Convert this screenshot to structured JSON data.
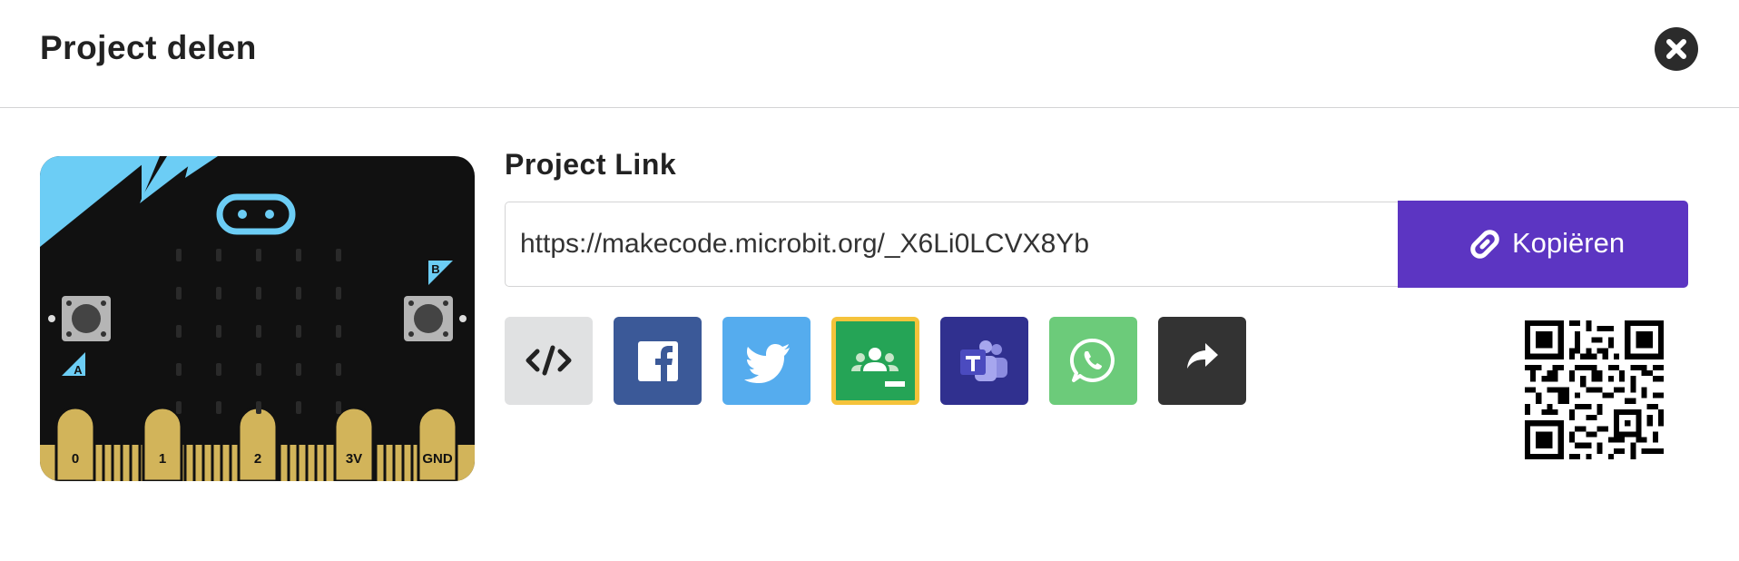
{
  "dialog": {
    "title": "Project delen",
    "close_icon": "close-icon"
  },
  "link": {
    "label": "Project Link",
    "url": "https://makecode.microbit.org/_X6Li0LCVX8Yb",
    "copy_label": "Kopiëren",
    "copy_icon": "link-icon"
  },
  "board": {
    "pins": [
      "0",
      "1",
      "2",
      "3V",
      "GND"
    ],
    "button_a": "A",
    "button_b": "B"
  },
  "share_buttons": [
    {
      "name": "embed",
      "icon": "code-icon",
      "color": "#e0e1e2"
    },
    {
      "name": "facebook",
      "icon": "facebook-icon",
      "color": "#3b5998"
    },
    {
      "name": "twitter",
      "icon": "twitter-icon",
      "color": "#55acee"
    },
    {
      "name": "google-classroom",
      "icon": "google-classroom-icon",
      "color": "#25a456"
    },
    {
      "name": "microsoft-teams",
      "icon": "teams-icon",
      "color": "#30308f"
    },
    {
      "name": "whatsapp",
      "icon": "whatsapp-icon",
      "color": "#6ccb7a"
    },
    {
      "name": "share",
      "icon": "share-arrow-icon",
      "color": "#333333"
    }
  ],
  "qr_code": {
    "icon": "qr-code-icon"
  },
  "colors": {
    "accent": "#5c35c2",
    "board_black": "#111111",
    "board_blue": "#6ccdf5",
    "board_gold": "#d2b45a"
  }
}
